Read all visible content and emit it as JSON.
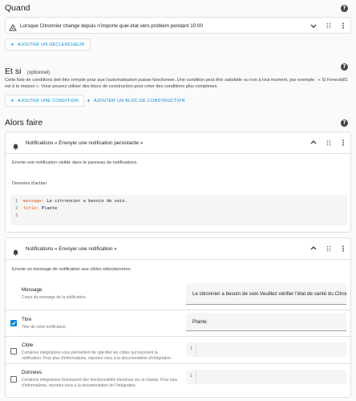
{
  "sections": {
    "when": "Quand",
    "and_if": "Et si",
    "and_if_optional": "(optionnel)",
    "then_do": "Alors faire"
  },
  "trigger": {
    "title": "Lorsque Citronnier change depuis n'importe quel état vers problem pendant 10:00",
    "add_label": "AJOUTER UN DÉCLENCHEUR"
  },
  "conditions": {
    "description": "Cette liste de conditions doit être remplie pour que l'automatisation puisse fonctionner. Une condition peut être satisfaite ou non à tout moment, par exemple : « Si Fenecki81 est à la maison ». Vous pouvez utiliser des blocs de construction pour créer des conditions plus complexes.",
    "add_condition": "AJOUTER UNE CONDITION",
    "add_block": "AJOUTER UN BLOC DE CONSTRUCTION"
  },
  "action1": {
    "title": "Notifications « Envoyer une notification persistante »",
    "description": "Envoie une notification visible dans le panneau de notifications.",
    "data_label": "Données d'action",
    "code_lines": [
      {
        "num": "1",
        "key": "message",
        "value": " Le citronnier a besoin de soin."
      },
      {
        "num": "2",
        "key": "title",
        "value": " Plante"
      },
      {
        "num": "3",
        "key": "",
        "value": ""
      }
    ]
  },
  "action2": {
    "title": "Notifications « Envoyer une notification »",
    "description": "Envoie un message de notification aux cibles sélectionnées.",
    "fields": {
      "message": {
        "label": "Message",
        "desc": "Corps du message de la notification.",
        "value": "Le citronnier a besoin de soin.Veuillez vérifier l'état de santé du Citronn"
      },
      "title": {
        "label": "Titre",
        "desc": "Titre de votre notification.",
        "value": "Plante",
        "checked": true
      },
      "target": {
        "label": "Cible",
        "desc": "Certaines intégrations vous permettent de spécifier les cibles qui reçoivent la notification. Pour plus d'informations, reportez-vous à la documentation d'intégration.",
        "line_num": "1",
        "checked": false
      },
      "data": {
        "label": "Données",
        "desc": "Certaines intégrations fournissent des fonctionnalités étendues via ce champ. Pour plus d'informations, reportez-vous à la documentation de l'intégration.",
        "line_num": "1",
        "checked": false
      }
    }
  },
  "colors": {
    "accent": "#0288d1",
    "yaml_key": "#e65100",
    "background": "#fafafa"
  },
  "icons": [
    "help-icon",
    "trigger-state-icon",
    "chevron-down-icon",
    "chevron-up-icon",
    "drag-handle-icon",
    "more-vert-icon",
    "plus-icon",
    "notification-icon",
    "check-icon"
  ]
}
